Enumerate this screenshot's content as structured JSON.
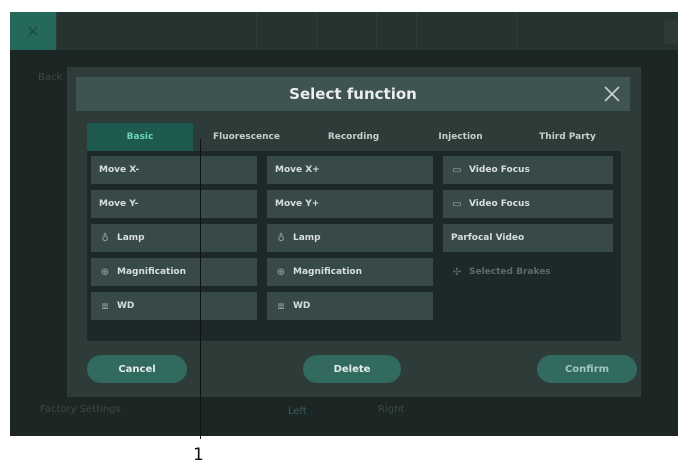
{
  "background": {
    "left_label": "Back",
    "factory_settings": "Factory Settings",
    "left_option": "Left",
    "right_option": "Right"
  },
  "dialog": {
    "title": "Select function",
    "tabs": [
      "Basic",
      "Fluorescence",
      "Recording",
      "Injection",
      "Third Party"
    ],
    "active_tab": "Basic",
    "functions": [
      {
        "label": "Move X-",
        "icon": ""
      },
      {
        "label": "Move X+",
        "icon": ""
      },
      {
        "label": "Video Focus",
        "icon": "video-icon"
      },
      {
        "label": "Move Y-",
        "icon": ""
      },
      {
        "label": "Move Y+",
        "icon": ""
      },
      {
        "label": "Video Focus",
        "icon": "video-icon"
      },
      {
        "label": "Lamp",
        "icon": "lamp-icon"
      },
      {
        "label": "Lamp",
        "icon": "lamp-icon"
      },
      {
        "label": "Parfocal Video",
        "icon": ""
      },
      {
        "label": "Magnification",
        "icon": "magnification-icon"
      },
      {
        "label": "Magnification",
        "icon": "magnification-icon"
      },
      {
        "label": "Selected Brakes",
        "icon": "brakes-icon",
        "disabled": true
      },
      {
        "label": "WD",
        "icon": "wd-icon"
      },
      {
        "label": "WD",
        "icon": "wd-icon"
      }
    ],
    "buttons": {
      "cancel": "Cancel",
      "delete": "Delete",
      "confirm": "Confirm"
    }
  },
  "callout": {
    "number": "1"
  },
  "colors": {
    "accent": "#1f5a50",
    "accent_text": "#6fd3b8",
    "pill": "#336a5f",
    "panel": "#2d3b39"
  }
}
